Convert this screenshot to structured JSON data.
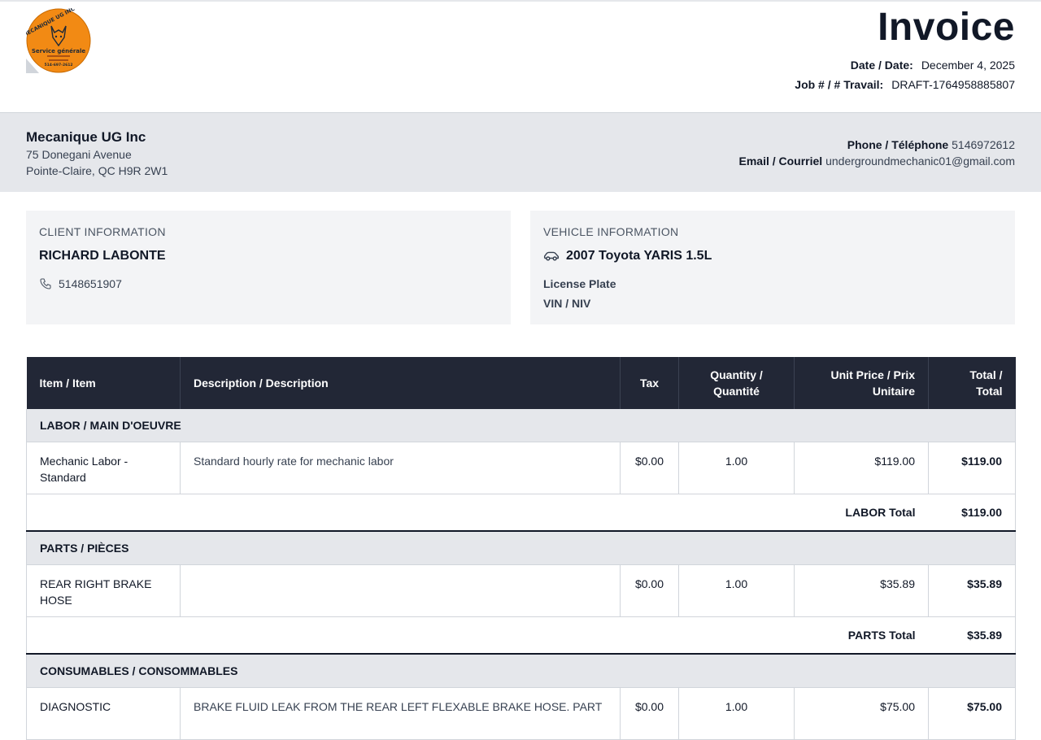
{
  "header": {
    "title": "Invoice",
    "date_label": "Date / Date:",
    "date_value": "December 4, 2025",
    "job_label": "Job # / # Travail:",
    "job_value": "DRAFT-1764958885807",
    "logo": {
      "text_top": "MECANIQUE UG INC",
      "text_main": "Service générale",
      "phone": "514-697-2612",
      "accent": "#f28a14"
    }
  },
  "company": {
    "name": "Mecanique UG Inc",
    "address1": "75 Donegani Avenue",
    "address2": "Pointe-Claire, QC H9R 2W1",
    "phone_label": "Phone / Téléphone",
    "phone_value": "5146972612",
    "email_label": "Email / Courriel",
    "email_value": "undergroundmechanic01@gmail.com"
  },
  "client": {
    "title": "CLIENT INFORMATION",
    "name": "RICHARD LABONTE",
    "phone": "5148651907"
  },
  "vehicle": {
    "title": "VEHICLE INFORMATION",
    "name": "2007 Toyota YARIS 1.5L",
    "plate_label": "License Plate",
    "vin_label": "VIN / NIV"
  },
  "table": {
    "headers": {
      "item": "Item / Item",
      "description": "Description / Description",
      "tax": "Tax",
      "quantity_1": "Quantity /",
      "quantity_2": "Quantité",
      "unit_1": "Unit Price / Prix",
      "unit_2": "Unitaire",
      "total_1": "Total /",
      "total_2": "Total"
    },
    "labor": {
      "section": "LABOR / MAIN D'OEUVRE",
      "item_1": "Mechanic Labor -",
      "item_2": "Standard",
      "description": "Standard hourly rate for mechanic labor",
      "tax": "$0.00",
      "quantity": "1.00",
      "unit_price": "$119.00",
      "total": "$119.00",
      "total_label": "LABOR Total",
      "total_value": "$119.00"
    },
    "parts": {
      "section": "PARTS / PIÈCES",
      "item_1": "REAR RIGHT BRAKE",
      "item_2": "HOSE",
      "description": "",
      "tax": "$0.00",
      "quantity": "1.00",
      "unit_price": "$35.89",
      "total": "$35.89",
      "total_label": "PARTS Total",
      "total_value": "$35.89"
    },
    "consumables": {
      "section": "CONSUMABLES / CONSOMMABLES",
      "item_1": "DIAGNOSTIC",
      "description": "BRAKE FLUID LEAK FROM THE REAR LEFT FLEXABLE BRAKE HOSE. PART",
      "tax": "$0.00",
      "quantity": "1.00",
      "unit_price": "$75.00",
      "total": "$75.00"
    }
  }
}
